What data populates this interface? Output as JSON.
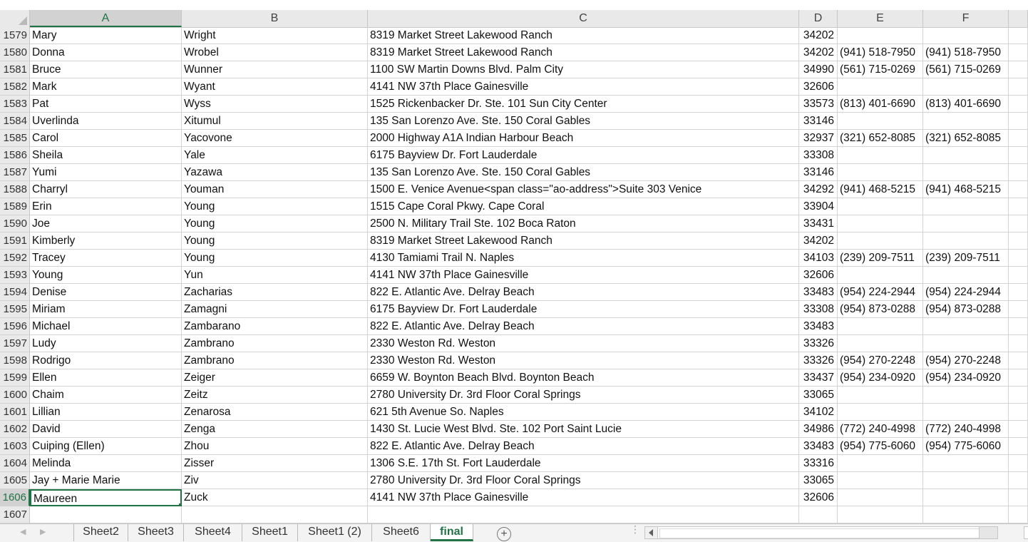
{
  "sheet": {
    "columns": [
      "A",
      "B",
      "C",
      "D",
      "E",
      "F"
    ],
    "selected_column": "A",
    "selected_row": "1606",
    "rows": [
      {
        "n": "1579",
        "a": "Mary",
        "b": "Wright",
        "c": "8319 Market Street Lakewood Ranch",
        "d": "34202",
        "e": "",
        "f": ""
      },
      {
        "n": "1580",
        "a": "Donna",
        "b": "Wrobel",
        "c": "8319 Market Street Lakewood Ranch",
        "d": "34202",
        "e": "(941) 518-7950",
        "f": "(941) 518-7950"
      },
      {
        "n": "1581",
        "a": "Bruce",
        "b": "Wunner",
        "c": "1100 SW Martin Downs Blvd. Palm City",
        "d": "34990",
        "e": "(561) 715-0269",
        "f": "(561) 715-0269"
      },
      {
        "n": "1582",
        "a": "Mark",
        "b": "Wyant",
        "c": "4141 NW 37th Place Gainesville",
        "d": "32606",
        "e": "",
        "f": ""
      },
      {
        "n": "1583",
        "a": "Pat",
        "b": "Wyss",
        "c": "1525 Rickenbacker Dr. Ste. 101 Sun City Center",
        "d": "33573",
        "e": "(813) 401-6690",
        "f": "(813) 401-6690"
      },
      {
        "n": "1584",
        "a": "Uverlinda",
        "b": "Xitumul",
        "c": "135 San Lorenzo Ave. Ste. 150 Coral Gables",
        "d": "33146",
        "e": "",
        "f": ""
      },
      {
        "n": "1585",
        "a": "Carol",
        "b": "Yacovone",
        "c": "2000 Highway A1A Indian Harbour Beach",
        "d": "32937",
        "e": "(321) 652-8085",
        "f": "(321) 652-8085"
      },
      {
        "n": "1586",
        "a": "Sheila",
        "b": "Yale",
        "c": "6175 Bayview Dr. Fort Lauderdale",
        "d": "33308",
        "e": "",
        "f": ""
      },
      {
        "n": "1587",
        "a": "Yumi",
        "b": "Yazawa",
        "c": "135 San Lorenzo Ave. Ste. 150 Coral Gables",
        "d": "33146",
        "e": "",
        "f": ""
      },
      {
        "n": "1588",
        "a": "Charryl",
        "b": "Youman",
        "c": "1500 E. Venice Avenue<span class=\"ao-address\">Suite 303  Venice",
        "d": "34292",
        "e": "(941) 468-5215",
        "f": "(941) 468-5215"
      },
      {
        "n": "1589",
        "a": "Erin",
        "b": "Young",
        "c": "1515 Cape Coral Pkwy. Cape Coral",
        "d": "33904",
        "e": "",
        "f": ""
      },
      {
        "n": "1590",
        "a": "Joe",
        "b": "Young",
        "c": "2500 N. Military Trail Ste. 102 Boca Raton",
        "d": "33431",
        "e": "",
        "f": ""
      },
      {
        "n": "1591",
        "a": "Kimberly",
        "b": "Young",
        "c": "8319 Market Street Lakewood Ranch",
        "d": "34202",
        "e": "",
        "f": ""
      },
      {
        "n": "1592",
        "a": "Tracey",
        "b": "Young",
        "c": "4130 Tamiami Trail N. Naples",
        "d": "34103",
        "e": "(239) 209-7511",
        "f": "(239) 209-7511"
      },
      {
        "n": "1593",
        "a": "Young",
        "b": "Yun",
        "c": "4141 NW 37th Place Gainesville",
        "d": "32606",
        "e": "",
        "f": ""
      },
      {
        "n": "1594",
        "a": "Denise",
        "b": "Zacharias",
        "c": "822 E. Atlantic Ave. Delray Beach",
        "d": "33483",
        "e": "(954) 224-2944",
        "f": "(954) 224-2944"
      },
      {
        "n": "1595",
        "a": "Miriam",
        "b": "Zamagni",
        "c": "6175 Bayview Dr. Fort Lauderdale",
        "d": "33308",
        "e": "(954) 873-0288",
        "f": "(954) 873-0288"
      },
      {
        "n": "1596",
        "a": "Michael",
        "b": "Zambarano",
        "c": "822 E. Atlantic Ave. Delray Beach",
        "d": "33483",
        "e": "",
        "f": ""
      },
      {
        "n": "1597",
        "a": "Ludy",
        "b": "Zambrano",
        "c": "2330 Weston Rd. Weston",
        "d": "33326",
        "e": "",
        "f": ""
      },
      {
        "n": "1598",
        "a": "Rodrigo",
        "b": "Zambrano",
        "c": "2330 Weston Rd. Weston",
        "d": "33326",
        "e": "(954) 270-2248",
        "f": "(954) 270-2248"
      },
      {
        "n": "1599",
        "a": "Ellen",
        "b": "Zeiger",
        "c": "6659 W. Boynton Beach Blvd. Boynton Beach",
        "d": "33437",
        "e": "(954) 234-0920",
        "f": "(954) 234-0920"
      },
      {
        "n": "1600",
        "a": "Chaim",
        "b": "Zeitz",
        "c": "2780 University Dr. 3rd Floor Coral Springs",
        "d": "33065",
        "e": "",
        "f": ""
      },
      {
        "n": "1601",
        "a": "Lillian",
        "b": "Zenarosa",
        "c": "621 5th Avenue So. Naples",
        "d": "34102",
        "e": "",
        "f": ""
      },
      {
        "n": "1602",
        "a": "David",
        "b": "Zenga",
        "c": "1430 St. Lucie West Blvd. Ste. 102 Port Saint Lucie",
        "d": "34986",
        "e": "(772) 240-4998",
        "f": "(772) 240-4998"
      },
      {
        "n": "1603",
        "a": "Cuiping (Ellen)",
        "b": "Zhou",
        "c": "822 E. Atlantic Ave. Delray Beach",
        "d": "33483",
        "e": "(954) 775-6060",
        "f": "(954) 775-6060"
      },
      {
        "n": "1604",
        "a": "Melinda",
        "b": "Zisser",
        "c": "1306 S.E. 17th St. Fort Lauderdale",
        "d": "33316",
        "e": "",
        "f": ""
      },
      {
        "n": "1605",
        "a": "Jay + Marie Marie",
        "b": "Ziv",
        "c": "2780 University Dr. 3rd Floor Coral Springs",
        "d": "33065",
        "e": "",
        "f": ""
      },
      {
        "n": "1606",
        "a": "Maureen",
        "b": "Zuck",
        "c": "4141 NW 37th Place Gainesville",
        "d": "32606",
        "e": "",
        "f": ""
      },
      {
        "n": "1607",
        "a": "",
        "b": "",
        "c": "",
        "d": "",
        "e": "",
        "f": ""
      }
    ]
  },
  "tabs": [
    {
      "label": "Sheet2",
      "active": false
    },
    {
      "label": "Sheet3",
      "active": false
    },
    {
      "label": "Sheet4",
      "active": false
    },
    {
      "label": "Sheet1",
      "active": false
    },
    {
      "label": "Sheet1 (2)",
      "active": false
    },
    {
      "label": "Sheet6",
      "active": false
    },
    {
      "label": "final",
      "active": true
    }
  ],
  "add_sheet_label": "+",
  "colors": {
    "accent": "#217346",
    "header_bg": "#e9e9e9",
    "gridline": "#d4d4d4"
  }
}
